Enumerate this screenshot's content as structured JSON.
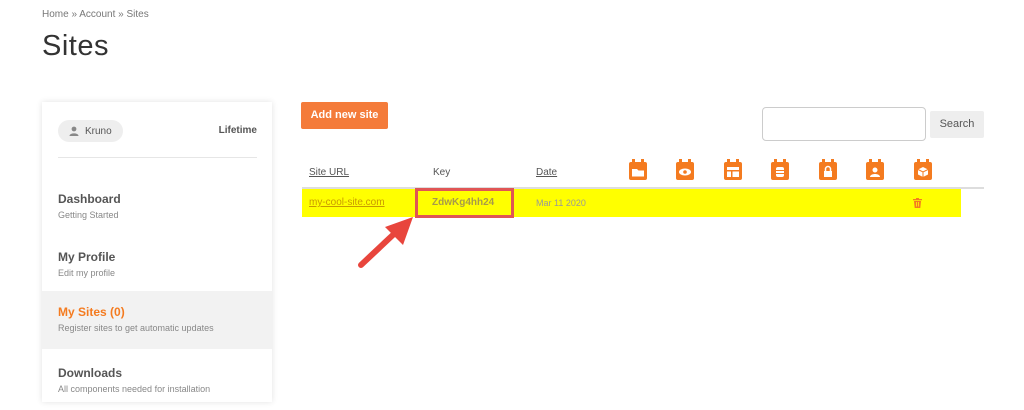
{
  "breadcrumb": "Home » Account » Sites",
  "page_title": "Sites",
  "sidebar": {
    "user_name": "Kruno",
    "plan": "Lifetime",
    "items": [
      {
        "title": "Dashboard",
        "sub": "Getting Started"
      },
      {
        "title": "My Profile",
        "sub": "Edit my profile"
      },
      {
        "title": "My Sites (0)",
        "sub": "Register sites to get automatic updates"
      },
      {
        "title": "Downloads",
        "sub": "All components needed for installation"
      }
    ]
  },
  "toolbar": {
    "add_label": "Add new site",
    "search_placeholder": "",
    "search_label": "Search"
  },
  "table": {
    "headers": [
      "Site URL",
      "Key",
      "Date"
    ],
    "header_icons": [
      "folder-calendar-icon",
      "eye-calendar-icon",
      "layout-calendar-icon",
      "database-calendar-icon",
      "lock-calendar-icon",
      "user-calendar-icon",
      "box-calendar-icon"
    ],
    "rows": [
      {
        "url": "my-cool-site.com",
        "key": "ZdwKg4hh24",
        "date": "Mar 11 2020"
      }
    ]
  },
  "colors": {
    "accent": "#f47b20",
    "highlight": "#ffff00",
    "annotation": "#e05555"
  }
}
